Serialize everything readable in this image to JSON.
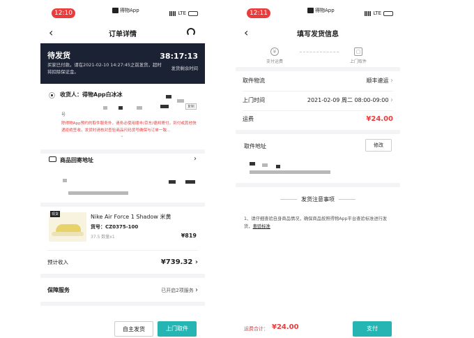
{
  "left": {
    "status": {
      "time": "12:10",
      "carrier": "得物App",
      "network": "LTE"
    },
    "nav": {
      "title": "订单详情"
    },
    "header": {
      "status": "待发货",
      "desc": "买家已付款。请在2021-02-10 14:27:45之前发货，超时将扣除保证金。",
      "countdown": "38:17:13",
      "countdown_label": "发货剩余时间"
    },
    "receiver": {
      "label": "收货人：得物App白冰冰",
      "copy": "复制",
      "no_prefix": "号",
      "notice": "除得物App预约的取件服务外，请务必使用顺丰/京东/德邦寄付，到付或其他快递拒绝签收，发货时请核对查验商品尺码货号确保与订单一致..."
    },
    "return_address": {
      "label": "商品回寄地址"
    },
    "product": {
      "tag": "现货",
      "name": "Nike Air Force 1 Shadow 米黄",
      "sku": "货号：CZ0375-100",
      "spec": "37.5  数量x1",
      "price": "¥819"
    },
    "income": {
      "label": "预计收入",
      "value": "¥739.32"
    },
    "guarantee": {
      "label": "保障服务",
      "value": "已开启2项服务"
    },
    "buttons": {
      "self_ship": "自主发货",
      "pickup": "上门取件"
    }
  },
  "right": {
    "status": {
      "time": "12:11",
      "carrier": "得物App",
      "network": "LTE"
    },
    "nav": {
      "title": "填写发货信息"
    },
    "steps": {
      "s1": "支付运费",
      "s2": "上门取件"
    },
    "logistics": {
      "label": "取件物流",
      "value": "顺丰速运"
    },
    "pickup_time": {
      "label": "上门时间",
      "value": "2021-02-09 周二 08:00-09:00"
    },
    "fee": {
      "label": "运费",
      "value": "¥24.00"
    },
    "address": {
      "label": "取件地址",
      "edit": "修改"
    },
    "notes": {
      "title": "发货注意事项",
      "text": "1、请仔细查验自身商品情况，确保商品按照得物App平台查验标准进行发货，",
      "link": "查验标准"
    },
    "footer": {
      "total_label": "运费合计：",
      "total_value": "¥24.00",
      "pay": "支付"
    }
  },
  "colors": {
    "accent_red": "#e93d3d",
    "teal": "#27b5b3",
    "dark_header": "#1b2233"
  }
}
